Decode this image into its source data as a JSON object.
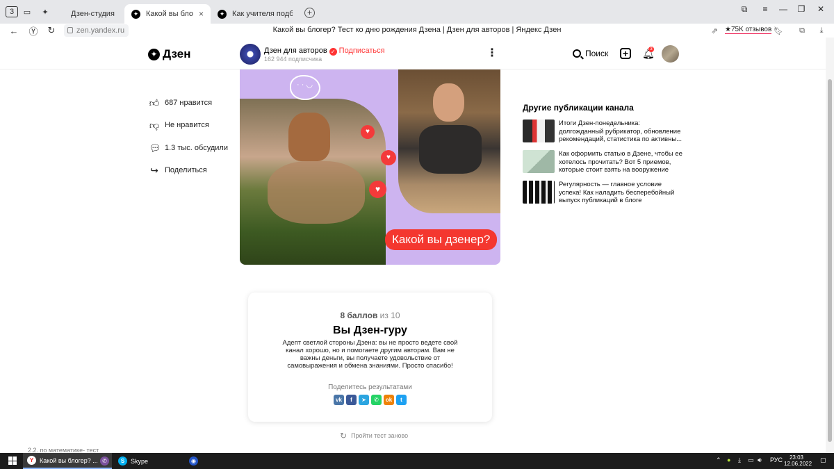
{
  "browser": {
    "tab_counter": "3",
    "tabs": [
      {
        "label": "Дзен-студия"
      },
      {
        "label": "Какой вы блогер? Тест"
      },
      {
        "label": "Как учителя подбирают"
      }
    ],
    "url": "zen.yandex.ru",
    "page_title": "Какой вы блогер? Тест ко дню рождения Дзена | Дзен для авторов | Яндекс Дзен",
    "reviews": "★75K отзывов"
  },
  "header": {
    "logo": "Дзен",
    "channel_name": "Дзен для авторов",
    "subscribe": "Подписаться",
    "subscribers": "162 944 подписчика",
    "search": "Поиск",
    "notifications": "3"
  },
  "actions": [
    {
      "label": "687 нравится"
    },
    {
      "label": "Не нравится"
    },
    {
      "label": "1.3 тыс. обсудили"
    },
    {
      "label": "Поделиться"
    }
  ],
  "cover": {
    "caption": "Какой вы дзенер?"
  },
  "other_publications": {
    "title": "Другие публикации канала",
    "items": [
      {
        "text": "Итоги Дзен-понедельника: долгожданный рубрикатор, обновление рекомендаций, статистика по активны..."
      },
      {
        "text": "Как оформить статью в Дзене, чтобы ее хотелось прочитать? Вот 5 приемов, которые стоит взять на вооружение"
      },
      {
        "text": "Регулярность — главное условие успеха! Как наладить бесперебойный выпуск публикаций в блоге"
      }
    ]
  },
  "result": {
    "score_value": "8 баллов",
    "score_suffix": "из 10",
    "verdict": "Вы Дзен-гуру",
    "description": "Адепт светлой стороны Дзена: вы не просто ведете свой канал хорошо, но и помогаете другим авторам. Вам не важны деньги, вы получаете удовольствие от самовыражения и обмена знаниями. Просто спасибо!",
    "share_label": "Поделитесь результатами",
    "share_buttons": [
      {
        "glyph": "vk",
        "color": "#4a76a8"
      },
      {
        "glyph": "f",
        "color": "#3b5998"
      },
      {
        "glyph": "➤",
        "color": "#2ca5e0"
      },
      {
        "glyph": "✆",
        "color": "#25d366"
      },
      {
        "glyph": "ok",
        "color": "#ee8208"
      },
      {
        "glyph": "t",
        "color": "#1da1f2"
      }
    ],
    "retry": "Пройти тест заново"
  },
  "taskbar": {
    "ghost_text": "2.2. по математике- тест",
    "apps": [
      {
        "label": "Какой вы блогер? ..."
      },
      {
        "label": "Skype"
      }
    ],
    "lang": "РУС",
    "time": "23:03",
    "date": "12.06.2022"
  }
}
